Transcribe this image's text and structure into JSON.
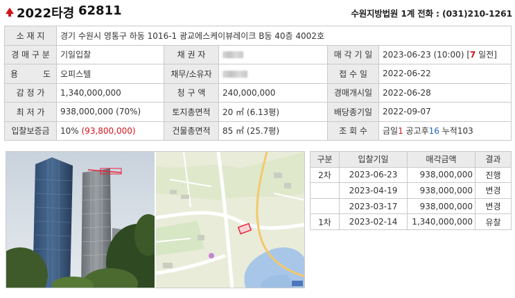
{
  "header": {
    "case_year": "2022타경",
    "case_number": "62811",
    "court_info": "수원지방법원 1계 전화 : (031)210-1261"
  },
  "info": {
    "location_label": "소 재 지",
    "location_value": "경기 수원시 영통구 하동 1016-1 광교에스케이뷰레이크 B동 40층 4002호",
    "auction_type_label": "경 매 구 분",
    "auction_type_value": "기일입찰",
    "creditor_label": "채 권 자",
    "sale_date_label": "매 각 기 일",
    "sale_date_value": "2023-06-23 (10:00) [",
    "sale_date_days": "7",
    "sale_date_suffix": " 일전]",
    "use_label": "용 도",
    "use_value": "오피스텔",
    "debtor_label": "채무/소유자",
    "receipt_label": "접 수 일",
    "receipt_value": "2022-06-22",
    "appraisal_label": "감 정 가",
    "appraisal_value": "1,340,000,000",
    "claim_label": "청 구 액",
    "claim_value": "240,000,000",
    "start_label": "경매개시일",
    "start_value": "2022-06-28",
    "minimum_label": "최 저 가",
    "minimum_value": "938,000,000 (70%)",
    "land_area_label": "토지총면적",
    "land_area_value": "20 ㎡ (6.13평)",
    "dividend_label": "배당종기일",
    "dividend_value": "2022-09-07",
    "deposit_label": "입찰보증금",
    "deposit_value": "10% ",
    "deposit_amount": "(93,800,000)",
    "building_area_label": "건물총면적",
    "building_area_value": "85 ㎡ (25.7평)",
    "views_label": "조 회 수",
    "views_today_label": "금일",
    "views_today": "1",
    "views_notice_label": " 공고후",
    "views_notice": "16",
    "views_total_label": " 누적",
    "views_total": "103"
  },
  "history": {
    "headers": [
      "구분",
      "입찰기일",
      "매각금액",
      "결과"
    ],
    "rows": [
      {
        "round": "2차",
        "date": "2023-06-23",
        "amount": "938,000,000",
        "result": "진행"
      },
      {
        "round": "",
        "date": "2023-04-19",
        "amount": "938,000,000",
        "result": "변경"
      },
      {
        "round": "",
        "date": "2023-03-17",
        "amount": "938,000,000",
        "result": "변경"
      },
      {
        "round": "1차",
        "date": "2023-02-14",
        "amount": "1,340,000,000",
        "result": "유찰"
      }
    ]
  },
  "colors": {
    "accent_red": "#d0141a",
    "accent_blue": "#1e62c8",
    "label_bg": "#ebebeb",
    "border": "#c9c9c9"
  },
  "icons": {
    "header_arrow": "up-arrow-icon"
  }
}
